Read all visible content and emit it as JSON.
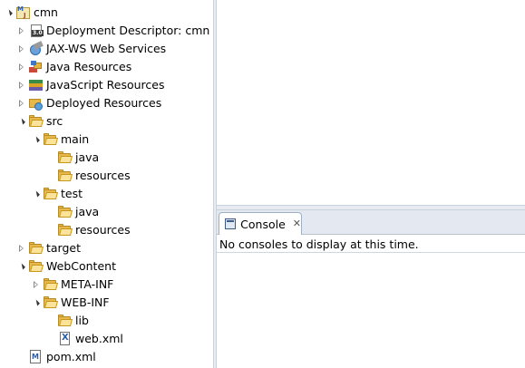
{
  "explorer": {
    "items": [
      {
        "label": "cmn",
        "icon": "maven-project-icon",
        "expand": "open"
      },
      {
        "label": "Deployment Descriptor: cmn",
        "icon": "deployment-descriptor-icon",
        "expand": "closed"
      },
      {
        "label": "JAX-WS Web Services",
        "icon": "web-services-icon",
        "expand": "closed"
      },
      {
        "label": "Java Resources",
        "icon": "java-resources-icon",
        "expand": "closed"
      },
      {
        "label": "JavaScript Resources",
        "icon": "javascript-resources-icon",
        "expand": "closed"
      },
      {
        "label": "Deployed Resources",
        "icon": "deployed-resources-icon",
        "expand": "closed"
      },
      {
        "label": "src",
        "icon": "folder-icon",
        "expand": "open"
      },
      {
        "label": "main",
        "icon": "folder-icon",
        "expand": "open"
      },
      {
        "label": "java",
        "icon": "folder-icon",
        "expand": "none"
      },
      {
        "label": "resources",
        "icon": "folder-icon",
        "expand": "none"
      },
      {
        "label": "test",
        "icon": "folder-icon",
        "expand": "open"
      },
      {
        "label": "java",
        "icon": "folder-icon",
        "expand": "none"
      },
      {
        "label": "resources",
        "icon": "folder-icon",
        "expand": "none"
      },
      {
        "label": "target",
        "icon": "folder-icon",
        "expand": "closed"
      },
      {
        "label": "WebContent",
        "icon": "folder-icon",
        "expand": "open"
      },
      {
        "label": "META-INF",
        "icon": "folder-icon",
        "expand": "closed"
      },
      {
        "label": "WEB-INF",
        "icon": "folder-icon",
        "expand": "open"
      },
      {
        "label": "lib",
        "icon": "folder-icon",
        "expand": "none"
      },
      {
        "label": "web.xml",
        "icon": "xml-file-icon",
        "expand": "none"
      },
      {
        "label": "pom.xml",
        "icon": "pom-file-icon",
        "expand": "none"
      }
    ]
  },
  "console": {
    "tab_label": "Console",
    "close_glyph": "✕",
    "message": "No consoles to display at this time."
  },
  "colors": {
    "view_border": "#c9d1dc",
    "tabbar_bg": "#e4e9f1",
    "folder": "#e9b84a"
  }
}
